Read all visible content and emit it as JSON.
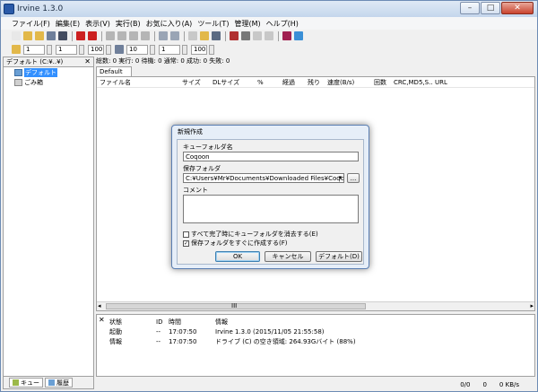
{
  "window": {
    "title": "Irvine 1.3.0",
    "minimize": "–",
    "maximize": "□",
    "close": "✕"
  },
  "menu": [
    "ファイル(F)",
    "編集(E)",
    "表示(V)",
    "実行(B)",
    "お気に入り(A)",
    "ツール(T)",
    "管理(M)",
    "ヘルプ(H)"
  ],
  "toolbar1": {
    "icons": [
      {
        "name": "new-icon",
        "color": "#e8e8e8"
      },
      {
        "name": "open-folder-icon",
        "color": "#e2b84a"
      },
      {
        "name": "open-icon",
        "color": "#e2b84a"
      },
      {
        "name": "save-icon",
        "color": "#6f7f9a"
      },
      {
        "name": "save-as-icon",
        "color": "#444c60"
      },
      {
        "name": "start-icon",
        "color": "#cc2020"
      },
      {
        "name": "start-all-icon",
        "color": "#cc2020"
      },
      {
        "name": "stop-icon",
        "color": "#b5b5b5"
      },
      {
        "name": "pause-icon",
        "color": "#b5b5b5"
      },
      {
        "name": "cut-icon",
        "color": "#b5b5b5"
      },
      {
        "name": "clear-icon",
        "color": "#b5b5b5"
      },
      {
        "name": "up-icon",
        "color": "#9aa5b5"
      },
      {
        "name": "down-icon",
        "color": "#9aa5b5"
      },
      {
        "name": "copy-icon",
        "color": "#c8c8c8"
      },
      {
        "name": "folder-icon",
        "color": "#e2b84a"
      },
      {
        "name": "properties-icon",
        "color": "#5a6a82"
      },
      {
        "name": "scissors-icon",
        "color": "#b03030"
      },
      {
        "name": "brush-icon",
        "color": "#777"
      },
      {
        "name": "paste-icon",
        "color": "#c8c8c8"
      },
      {
        "name": "page-icon",
        "color": "#c8c8c8"
      },
      {
        "name": "book-icon",
        "color": "#a02050"
      },
      {
        "name": "globe-icon",
        "color": "#3a8fd6"
      }
    ]
  },
  "toolbar2": {
    "v1": "1",
    "v2": "1",
    "v3": "100",
    "v4": "10",
    "v5": "1",
    "v6": "100"
  },
  "left_panel": {
    "header": "デフォルト (C:¥..¥)",
    "close": "✕",
    "tree": [
      {
        "label": "デフォルト",
        "selected": true
      },
      {
        "label": "ごみ箱",
        "selected": false
      }
    ],
    "tabs": [
      "キュー",
      "履歴"
    ]
  },
  "status_line": "総数: 0  実行: 0  待機: 0  通常: 0  成功: 0  失敗: 0",
  "queue_tab": "Default",
  "list_columns": [
    "ファイル名",
    "サイズ",
    "DLサイズ",
    "%",
    "経過",
    "残り",
    "速度(B/s)",
    "回数",
    "CRC,MD5,S...",
    "URL"
  ],
  "hscroll": {
    "left": "◂",
    "grip": "III",
    "right": "▸"
  },
  "log": {
    "close": "✕",
    "columns": [
      "状態",
      "ID",
      "時間",
      "情報"
    ],
    "rows": [
      {
        "state": "起動",
        "id": "--",
        "time": "17:07:50",
        "info": "Irvine 1.3.0 (2015/11/05 21:55:58)"
      },
      {
        "state": "情報",
        "id": "--",
        "time": "17:07:50",
        "info": "ドライブ (C) の空き領域: 264.93Gバイト (88%)"
      }
    ]
  },
  "statusbar": {
    "count": "0/0",
    "speed": "0 KB/s",
    "extra": "0"
  },
  "dialog": {
    "title": "新規作成",
    "queue_folder_label": "キューフォルダ名",
    "queue_folder_value": "Coqoon",
    "save_folder_label": "保存フォルダ",
    "save_folder_value": "C:¥Users¥Mr¥Documents¥Downloaded Files¥Coqoon",
    "browse": "...",
    "combo_arrow": "▾",
    "comment_label": "コメント",
    "check1": {
      "label": "すべて完了時にキューフォルダを消去する(E)",
      "checked": false
    },
    "check2": {
      "label": "保存フォルダをすぐに作成する(F)",
      "checked": true
    },
    "ok": "OK",
    "cancel": "キャンセル",
    "default": "デフォルト(D)",
    "check_mark": "✓"
  }
}
